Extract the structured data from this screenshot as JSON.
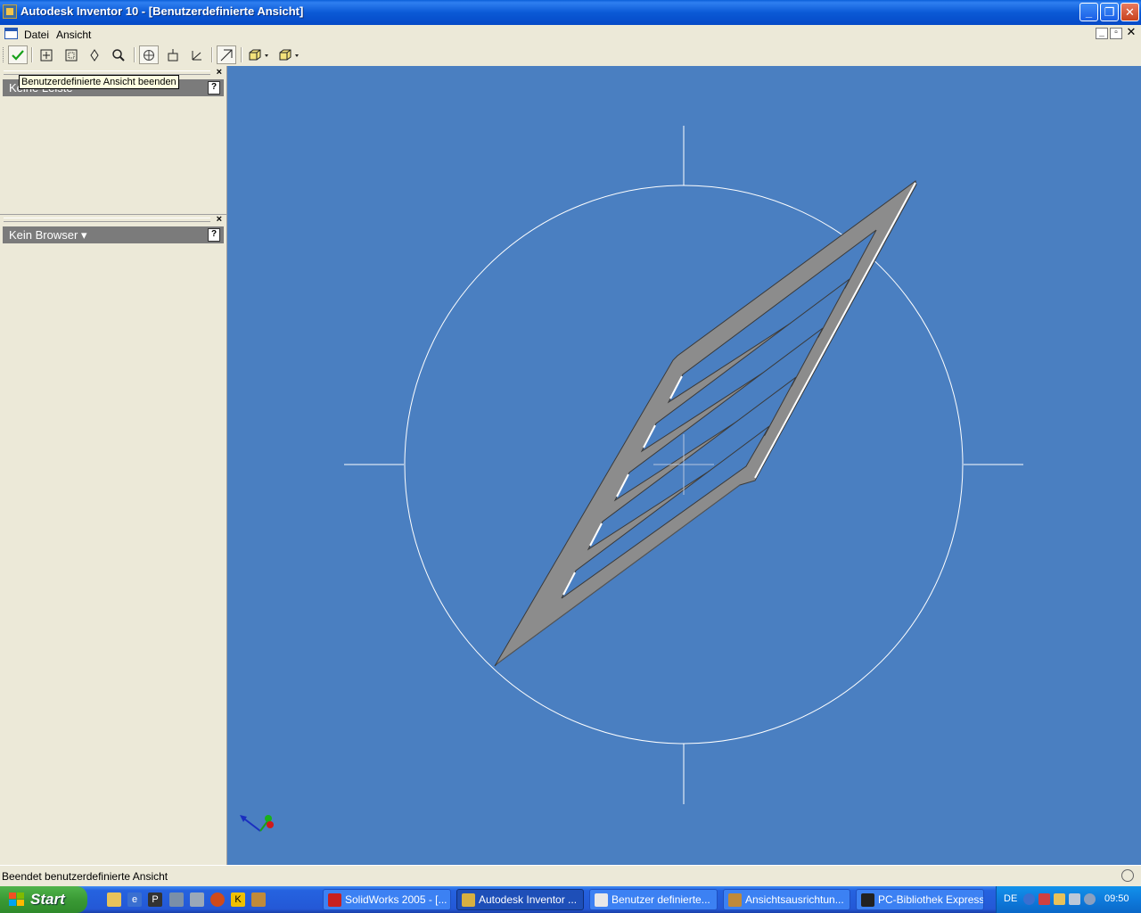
{
  "window": {
    "title": "Autodesk Inventor 10 - [Benutzerdefinierte Ansicht]",
    "buttons": {
      "minimize": "_",
      "restore": "❐",
      "close": "✕"
    }
  },
  "menu": {
    "items": [
      {
        "label": "Datei"
      },
      {
        "label": "Ansicht"
      }
    ]
  },
  "toolbar": {
    "tooltip": "Benutzerdefinierte Ansicht beenden",
    "icons": [
      "finish-check-icon",
      "zoom-all-icon",
      "zoom-window-icon",
      "pan-icon",
      "zoom-icon",
      "rotate-icon",
      "look-at-icon",
      "custom-view-icon",
      "display-style-icon",
      "shaded-display-icon"
    ]
  },
  "panels": {
    "panel_bar": {
      "title": "Keine Leiste",
      "help": "?"
    },
    "browser": {
      "title": "Kein Browser",
      "dropdown": "▾",
      "help": "?"
    }
  },
  "status": {
    "text": "Beendet benutzerdefinierte Ansicht"
  },
  "taskbar": {
    "start_label": "Start",
    "tasks": [
      {
        "label": "SolidWorks 2005 - [..."
      },
      {
        "label": "Autodesk Inventor ..."
      },
      {
        "label": "Benutzer definierte..."
      },
      {
        "label": "Ansichtsausrichtun..."
      },
      {
        "label": "PC-Bibliothek Express"
      }
    ],
    "tray": {
      "language": "DE",
      "clock": "09:50"
    }
  },
  "colors": {
    "viewport_bg": "#4a7fc1",
    "part_fill": "#8a8a8a",
    "part_edge": "#3a3a3a"
  }
}
